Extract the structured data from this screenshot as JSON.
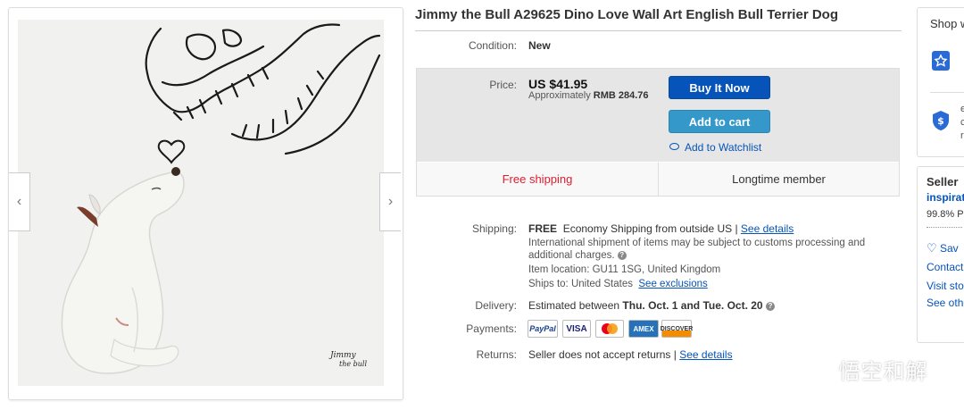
{
  "title": "Jimmy the Bull A29625 Dino Love Wall Art English Bull Terrier Dog",
  "condition": {
    "label": "Condition:",
    "value": "New"
  },
  "price": {
    "label": "Price:",
    "value": "US $41.95",
    "approx_prefix": "Approximately",
    "approx_value": "RMB 284.76"
  },
  "buttons": {
    "buy_now": "Buy It Now",
    "add_to_cart": "Add to cart",
    "watchlist": "Add to Watchlist"
  },
  "badges": {
    "free_shipping": "Free shipping",
    "longtime": "Longtime member"
  },
  "shipping": {
    "label": "Shipping:",
    "free": "FREE",
    "method": "Economy Shipping from outside US |",
    "details_link": "See details",
    "international": "International shipment of items may be subject to customs processing and additional charges.",
    "location_label": "Item location:",
    "location": "GU11 1SG, United Kingdom",
    "ships_to_label": "Ships to:",
    "ships_to": "United States",
    "exclusions_link": "See exclusions"
  },
  "delivery": {
    "label": "Delivery:",
    "prefix": "Estimated between",
    "start": "Thu. Oct. 1",
    "and": "and",
    "end": "Tue. Oct. 20"
  },
  "payments": {
    "label": "Payments:",
    "methods": [
      "PayPal",
      "VISA",
      "MasterCard",
      "AMEX",
      "DISCOVER"
    ]
  },
  "returns": {
    "label": "Returns:",
    "text": "Seller does not accept returns |",
    "details_link": "See details"
  },
  "artwork_signature": "Jimmy the Bull",
  "right_panel": {
    "shop_title": "Shop w",
    "shield_text": [
      "e",
      "c",
      "r"
    ],
    "seller_title": "Seller",
    "seller_name": "inspirat",
    "feedback": "99.8% P",
    "save": "Sav",
    "contact": "Contact",
    "visit_store": "Visit stor",
    "see_other": "See othe"
  },
  "watermark": "悟空和解",
  "colors": {
    "link": "#0654ba",
    "buy_button": "#0654ba",
    "cart_button": "#3498ca",
    "free_shipping": "#dd1e31"
  }
}
